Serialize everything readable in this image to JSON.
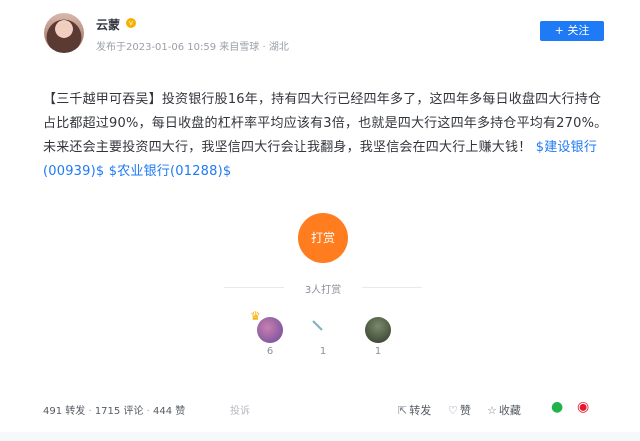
{
  "author": {
    "name": "云蒙",
    "badge": "v",
    "meta": "发布于2023-01-06 10:59  来自雪球  · 湖北"
  },
  "follow_button": "+ 关注",
  "post": {
    "tag": "【三千越甲可吞吴】",
    "text": "投资银行股16年，持有四大行已经四年多了，这四年多每日收盘四大行持仓占比都超过90%，每日收盘的杠杆率平均应该有3倍，也就是四大行这四年多持仓平均有270%。未来还会主要投资四大行，我坚信四大行会让我翻身，我坚信会在四大行上赚大钱！",
    "stock1": "$建设银行(00939)$",
    "stock2": "$农业银行(01288)$"
  },
  "reward": {
    "button": "打赏",
    "count_text": "3人打赏",
    "donors": [
      {
        "count": "6"
      },
      {
        "count": "1"
      },
      {
        "count": "1"
      }
    ]
  },
  "stats": {
    "reposts": "491 转发",
    "comments": "1715 评论",
    "likes": "444 赞",
    "report": "投诉"
  },
  "actions": {
    "repost": "转发",
    "like": "赞",
    "favorite": "收藏"
  },
  "icons": [
    "share-icon",
    "thumb-up-icon",
    "star-icon",
    "wechat-icon",
    "weibo-icon"
  ],
  "colors": {
    "accent": "#1f7af5",
    "reward": "#ff7d1f"
  }
}
